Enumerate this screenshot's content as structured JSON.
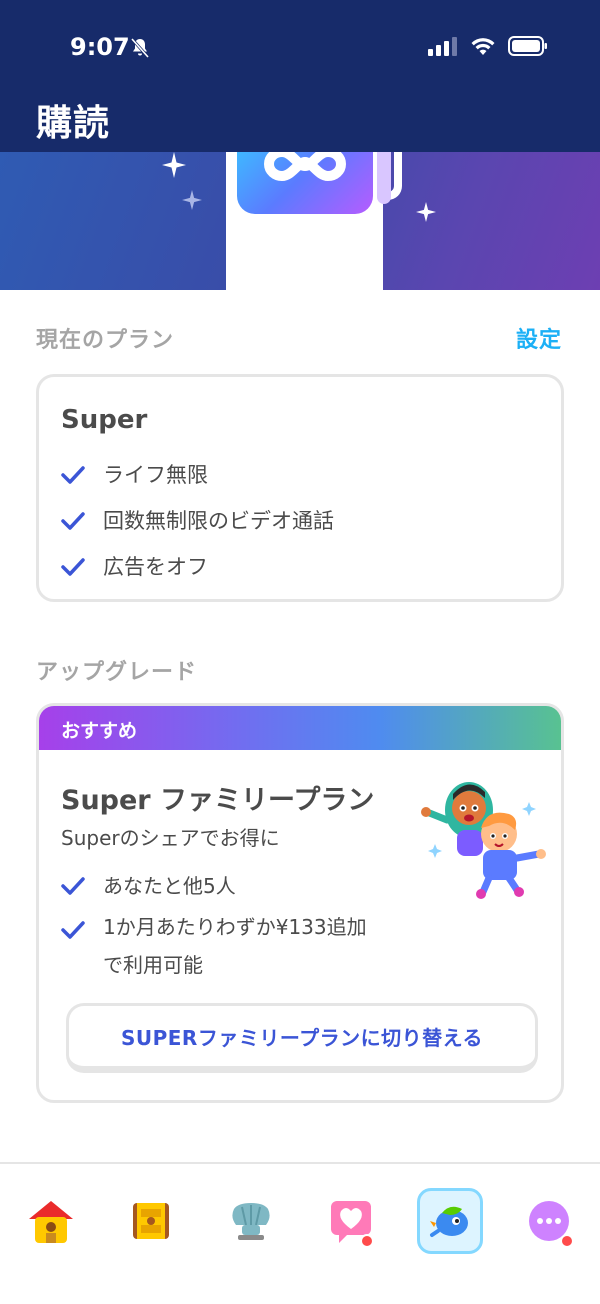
{
  "status": {
    "time": "9:07"
  },
  "header": {
    "title": "購読"
  },
  "current_plan": {
    "section_label": "現在のプラン",
    "settings_link": "設定",
    "plan_name": "Super",
    "features": [
      "ライフ無限",
      "回数無制限のビデオ通話",
      "広告をオフ"
    ]
  },
  "upgrade": {
    "section_label": "アップグレード",
    "badge": "おすすめ",
    "title": "Super ファミリープラン",
    "subtitle": "Superのシェアでお得に",
    "features": [
      "あなたと他5人",
      "1か月あたりわずか¥133追加",
      "で利用可能"
    ],
    "button_label": "SUPERファミリープランに切り替える"
  },
  "tabbar": {
    "items": [
      "home-icon",
      "chest-icon",
      "shell-icon",
      "heart-message-icon",
      "super-duo-icon",
      "more-icon"
    ],
    "active_index": 4
  },
  "colors": {
    "header_bg": "#172b6a",
    "accent_blue": "#1cb0f6",
    "button_text": "#3b55d6",
    "check": "#3b55d6",
    "notification": "#ff4b4b"
  }
}
